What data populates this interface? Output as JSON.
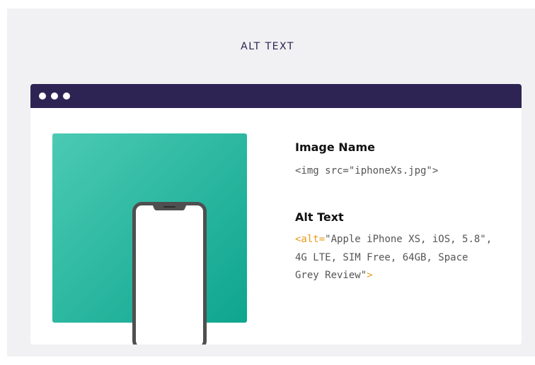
{
  "page": {
    "heading": "ALT TEXT"
  },
  "window": {
    "titlebar_dots": 3
  },
  "colors": {
    "titlebar": "#2e2454",
    "gradient_start": "#4bcab4",
    "gradient_end": "#0ea58e",
    "accent": "#e69a1b",
    "phone_frame": "#4f4f4f",
    "screen": "#ffffff"
  },
  "preview": {
    "icon": "smartphone-icon"
  },
  "image_name": {
    "title": "Image Name",
    "code": "<img src=\"iphoneXs.jpg\">"
  },
  "alt_text": {
    "title": "Alt Text",
    "open_tag": "<alt=",
    "line1_rest": "\"Apple iPhone XS, iOS, 5.8\",",
    "line2": "4G LTE, SIM Free, 64GB, Space",
    "line3": "Grey Review\"",
    "close_tag": ">"
  }
}
